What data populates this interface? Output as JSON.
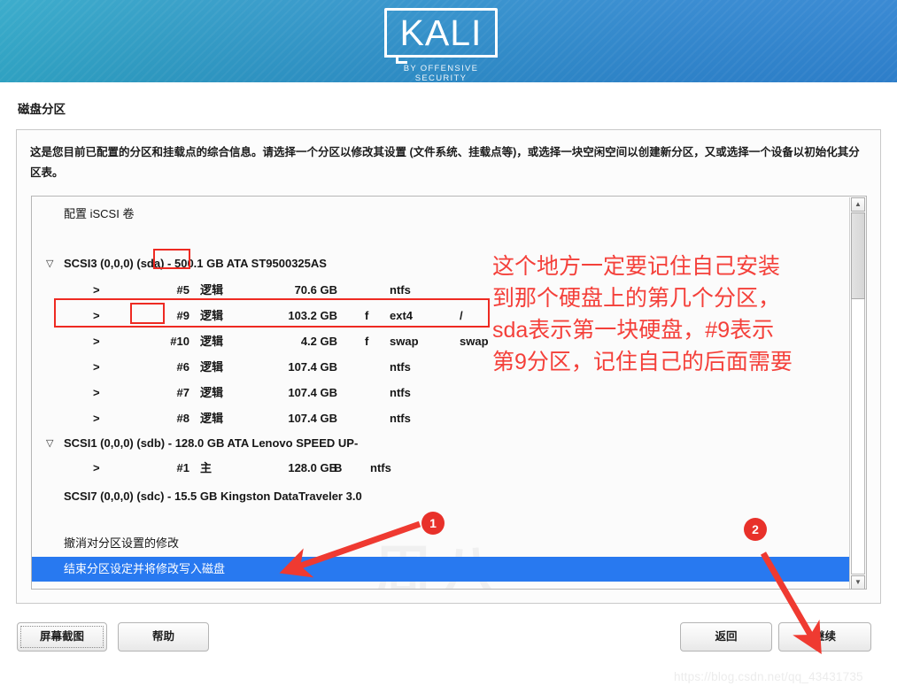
{
  "banner": {
    "logo_word": "KALI",
    "logo_subtitle": "BY OFFENSIVE SECURITY"
  },
  "page_title": "磁盘分区",
  "intro_text": "这是您目前已配置的分区和挂载点的综合信息。请选择一个分区以修改其设置 (文件系统、挂载点等)，或选择一块空闲空间以创建新分区，又或选择一个设备以初始化其分区表。",
  "list": {
    "rows": [
      {
        "kind": "action",
        "label": "配置 iSCSI 卷"
      },
      {
        "kind": "disk",
        "triangle": "▽",
        "label": "SCSI3 (0,0,0) (sda) - 500.1 GB ATA ST9500325AS"
      },
      {
        "kind": "part",
        "expander": ">",
        "number": "#5",
        "type": "逻辑",
        "size": "70.6 GB",
        "flag": "",
        "fs": "ntfs",
        "mount": ""
      },
      {
        "kind": "part",
        "expander": ">",
        "number": "#9",
        "type": "逻辑",
        "size": "103.2 GB",
        "flag": "f",
        "fs": "ext4",
        "mount": "/"
      },
      {
        "kind": "part",
        "expander": ">",
        "number": "#10",
        "type": "逻辑",
        "size": "4.2 GB",
        "flag": "f",
        "fs": "swap",
        "mount": "swap"
      },
      {
        "kind": "part",
        "expander": ">",
        "number": "#6",
        "type": "逻辑",
        "size": "107.4 GB",
        "flag": "",
        "fs": "ntfs",
        "mount": ""
      },
      {
        "kind": "part",
        "expander": ">",
        "number": "#7",
        "type": "逻辑",
        "size": "107.4 GB",
        "flag": "",
        "fs": "ntfs",
        "mount": ""
      },
      {
        "kind": "part",
        "expander": ">",
        "number": "#8",
        "type": "逻辑",
        "size": "107.4 GB",
        "flag": "",
        "fs": "ntfs",
        "mount": ""
      },
      {
        "kind": "disk",
        "triangle": "▽",
        "label": "SCSI1 (0,0,0) (sdb) - 128.0 GB ATA Lenovo SPEED UP-"
      },
      {
        "kind": "part-alt",
        "expander": ">",
        "number": "#1",
        "type": "主",
        "size": "128.0 GB",
        "flag": "B",
        "fs": "ntfs",
        "mount": ""
      },
      {
        "kind": "disk-noexp",
        "label": "SCSI7 (0,0,0) (sdc) - 15.5 GB Kingston DataTraveler 3.0"
      },
      {
        "kind": "action",
        "label": "撤消对分区设置的修改"
      },
      {
        "kind": "action-selected",
        "label": "结束分区设定并将修改写入磁盘"
      }
    ]
  },
  "annotations": {
    "note_lines": [
      "这个地方一定要记住自己安装",
      "到那个硬盘上的第几个分区，",
      "sda表示第一块硬盘，#9表示",
      "第9分区，记住自己的后面需要"
    ],
    "marker_1": "1",
    "marker_2": "2",
    "accent_color": "#f4403a"
  },
  "footer": {
    "screenshot_label": "屏幕截图",
    "help_label": "帮助",
    "back_label": "返回",
    "continue_label": "继续"
  },
  "watermarks": {
    "center": "周八",
    "url": "https://blog.csdn.net/qq_43431735"
  }
}
